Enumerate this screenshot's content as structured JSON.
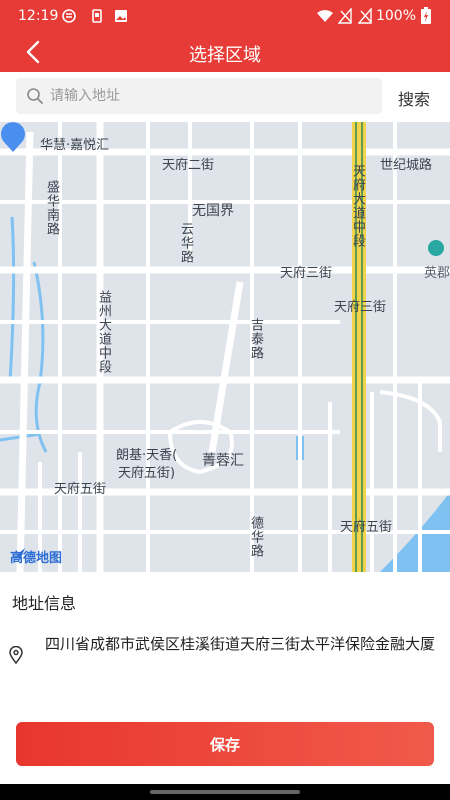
{
  "status_bar": {
    "time": "12:19",
    "battery": "100%",
    "icons": [
      "notification-icon",
      "device-icon",
      "image-icon",
      "wifi-icon",
      "signal-off-icon",
      "signal-off-icon",
      "battery-charging-icon"
    ]
  },
  "header": {
    "title": "选择区域",
    "back_icon": "chevron-left-icon"
  },
  "search": {
    "placeholder": "请输入地址",
    "value": "",
    "button_label": "搜索"
  },
  "map": {
    "provider_logo": "高德地图",
    "labels": {
      "huahui": "华慧·嘉悦汇",
      "tianfu_2nd": "天府二街",
      "shiji_road": "世纪城路",
      "shenghua_south": "盛华南路",
      "wuguojie": "无国界",
      "yunhua_road": "云华路",
      "tianfu_ave_middle": "天府大道中段",
      "yidu": "英郡",
      "tianfu_3rd_a": "天府三街",
      "tianfu_3rd_b": "天府三街",
      "yizhou_ave_middle": "益州大道中段",
      "jitai_road": "吉泰路",
      "langji_1": "朗基·天香(",
      "langji_2": "天府五街)",
      "jingrong": "菁蓉汇",
      "tianfu_5th_a": "天府五街",
      "tianfu_5th_b": "天府五街",
      "dehua_road": "德华路"
    }
  },
  "address": {
    "section_title": "地址信息",
    "text": "四川省成都市武侯区桂溪街道天府三街太平洋保险金融大厦",
    "icon": "location-pin-icon"
  },
  "actions": {
    "save_label": "保存"
  },
  "colors": {
    "brand_red": "#e63b36",
    "map_pin": "#4a8ff0",
    "road": "#ffffff",
    "water": "#7fc2f2",
    "highway": "#f3d34a"
  }
}
